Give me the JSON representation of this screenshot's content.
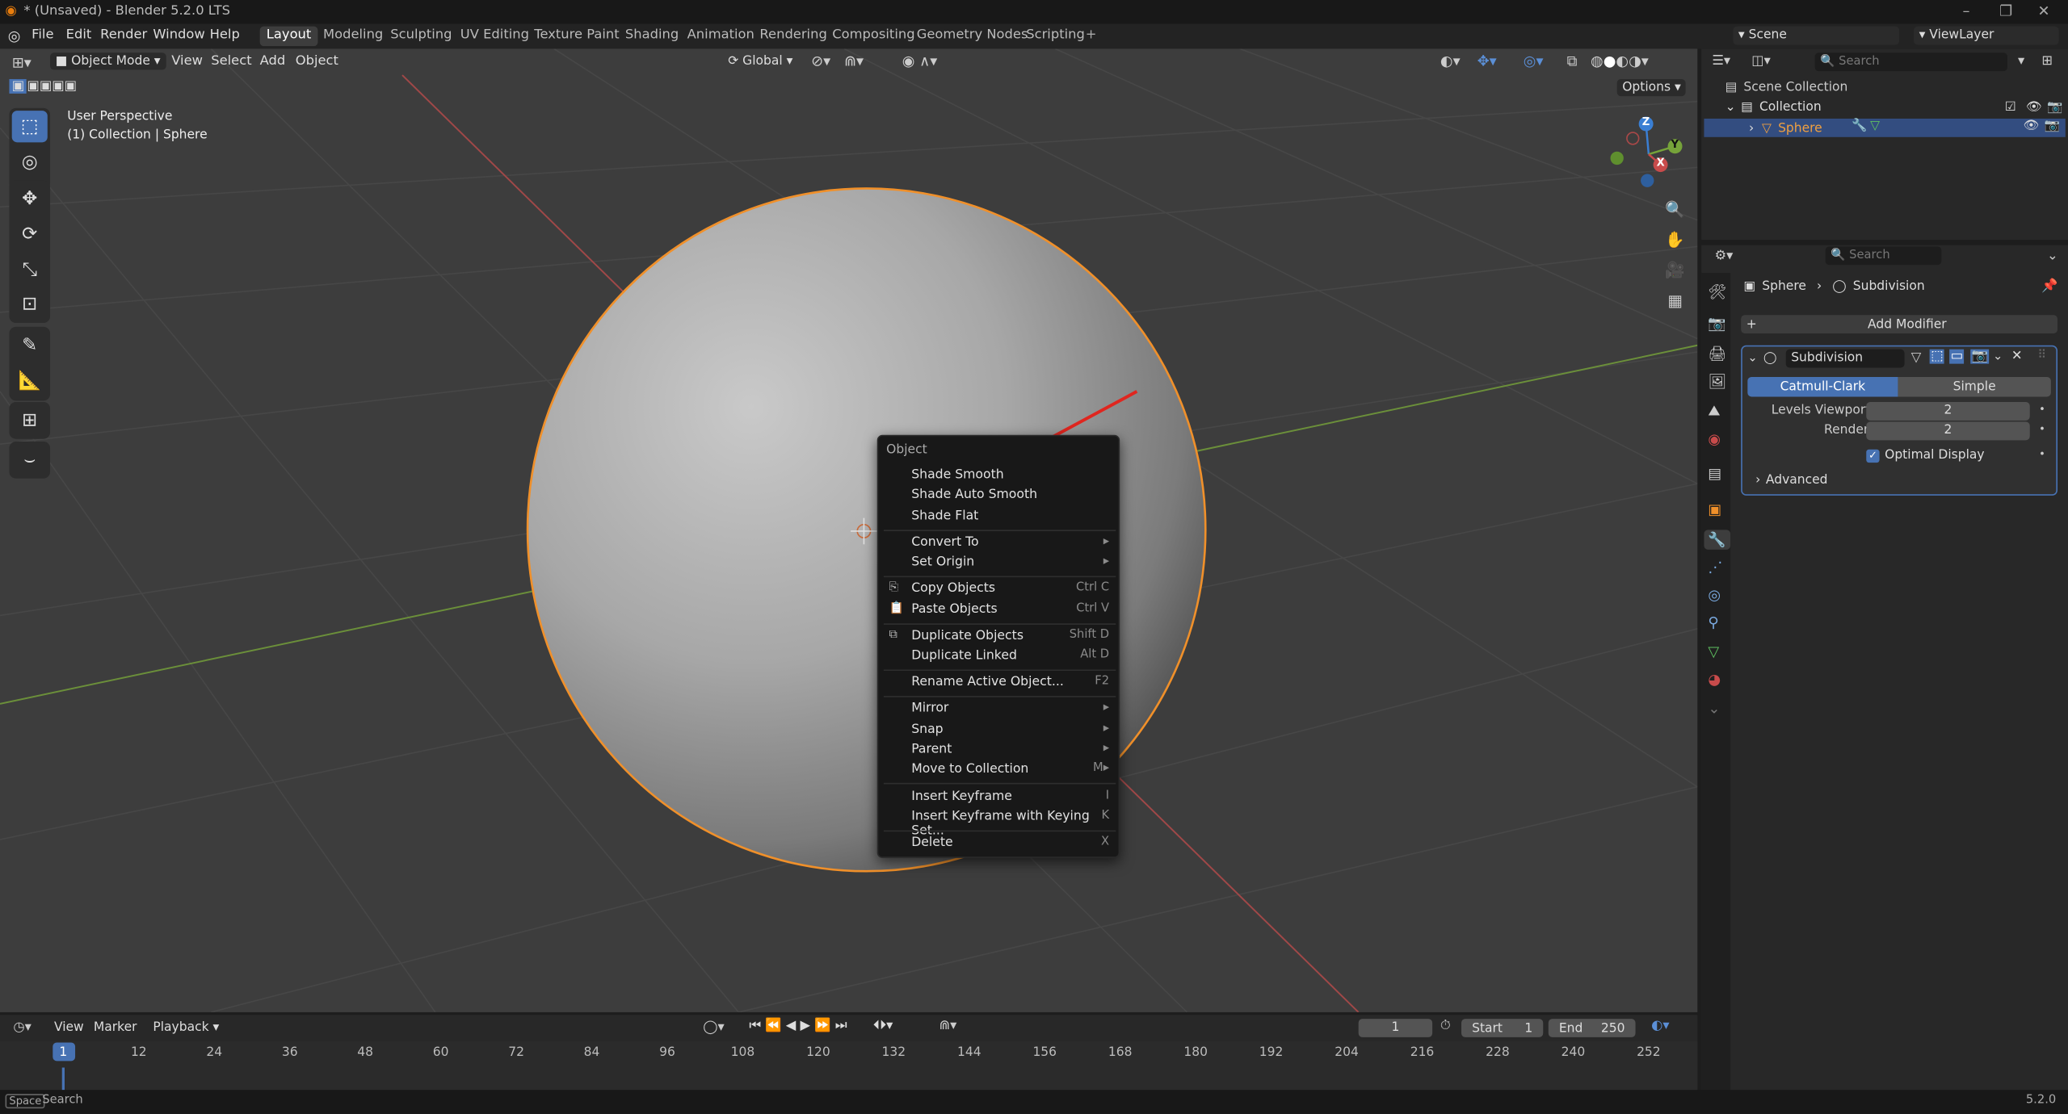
{
  "titlebar": {
    "title": "* (Unsaved) - Blender 5.2.0 LTS"
  },
  "menubar": {
    "menus": [
      "File",
      "Edit",
      "Render",
      "Window",
      "Help"
    ],
    "workspaces": [
      "Layout",
      "Modeling",
      "Sculpting",
      "UV Editing",
      "Texture Paint",
      "Shading",
      "Animation",
      "Rendering",
      "Compositing",
      "Geometry Nodes",
      "Scripting"
    ],
    "active_workspace": "Layout",
    "scene": "Scene",
    "view_layer": "ViewLayer"
  },
  "viewport_header": {
    "mode": "Object Mode",
    "menus": [
      "View",
      "Select",
      "Add",
      "Object"
    ],
    "orientation": "Global",
    "options_label": "Options"
  },
  "viewport": {
    "perspective_label": "User Perspective",
    "collection_label": "(1) Collection | Sphere",
    "gizmo_axes": {
      "z": "Z",
      "y": "Y",
      "x": "X"
    }
  },
  "context_menu": {
    "title": "Object",
    "items": [
      {
        "label": "Shade Smooth",
        "shortcut": ""
      },
      {
        "label": "Shade Auto Smooth",
        "shortcut": ""
      },
      {
        "label": "Shade Flat",
        "shortcut": ""
      },
      {
        "label": "Convert To",
        "shortcut": "▸"
      },
      {
        "label": "Set Origin",
        "shortcut": "▸"
      },
      {
        "label": "Copy Objects",
        "shortcut": "Ctrl C"
      },
      {
        "label": "Paste Objects",
        "shortcut": "Ctrl V"
      },
      {
        "label": "Duplicate Objects",
        "shortcut": "Shift D"
      },
      {
        "label": "Duplicate Linked",
        "shortcut": "Alt D"
      },
      {
        "label": "Rename Active Object...",
        "shortcut": "F2"
      },
      {
        "label": "Mirror",
        "shortcut": "▸"
      },
      {
        "label": "Snap",
        "shortcut": "▸"
      },
      {
        "label": "Parent",
        "shortcut": "▸"
      },
      {
        "label": "Move to Collection",
        "shortcut": "M▸"
      },
      {
        "label": "Insert Keyframe",
        "shortcut": "I"
      },
      {
        "label": "Insert Keyframe with Keying Set...",
        "shortcut": "K"
      },
      {
        "label": "Delete",
        "shortcut": "X"
      }
    ]
  },
  "outliner": {
    "search_placeholder": "Search",
    "scene_collection": "Scene Collection",
    "collection": "Collection",
    "object": "Sphere"
  },
  "properties": {
    "search_placeholder": "Search",
    "breadcrumb_object": "Sphere",
    "breadcrumb_modifier": "Subdivision",
    "add_modifier": "Add Modifier",
    "modifier_name": "Subdivision",
    "method_options": [
      "Catmull-Clark",
      "Simple"
    ],
    "active_method": "Catmull-Clark",
    "levels_viewport_label": "Levels Viewport",
    "levels_viewport_value": "2",
    "render_label": "Render",
    "render_value": "2",
    "optimal_display_label": "Optimal Display",
    "optimal_display_checked": true,
    "advanced_label": "Advanced"
  },
  "timeline": {
    "menus": [
      "View",
      "Marker",
      "Playback"
    ],
    "current_frame": "1",
    "start_label": "Start",
    "start_value": "1",
    "end_label": "End",
    "end_value": "250",
    "frame_marks": [
      "1",
      "12",
      "24",
      "36",
      "48",
      "60",
      "72",
      "84",
      "96",
      "108",
      "120",
      "132",
      "144",
      "156",
      "168",
      "180",
      "192",
      "204",
      "216",
      "228",
      "240",
      "252"
    ]
  },
  "statusbar": {
    "key": "Space",
    "action": "Search",
    "version": "5.2.0"
  },
  "colors": {
    "accent": "#4772b3",
    "selection_outline": "#f0902a",
    "x_axis": "#c84b4b",
    "y_axis": "#76a33a",
    "z_axis": "#3a7fd4",
    "arrow": "#e0261f"
  }
}
